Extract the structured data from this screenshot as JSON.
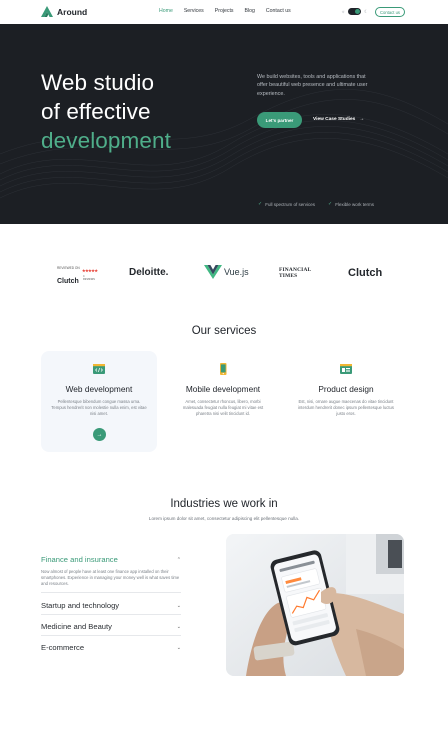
{
  "header": {
    "logo_text": "Around",
    "nav": [
      {
        "label": "Home",
        "active": true
      },
      {
        "label": "Services",
        "active": false
      },
      {
        "label": "Projects",
        "active": false
      },
      {
        "label": "Blog",
        "active": false
      },
      {
        "label": "Contact us",
        "active": false
      }
    ],
    "contact_button": "Contact us",
    "theme_toggle": {
      "on": true,
      "sun_icon": "sun-icon",
      "moon_icon": "moon-icon"
    }
  },
  "hero": {
    "title_line1": "Web studio",
    "title_line2": "of effective",
    "title_accent": "development",
    "description": "We build websites, tools and applications that offer beautiful web presence and ultimate user experience.",
    "primary_button": "Let's partner",
    "secondary_button": "View Case Studies",
    "checks": [
      "Full spectrum of services",
      "Flexible work terms"
    ]
  },
  "logos": {
    "clutch_small": {
      "reviewed": "REVIEWED ON",
      "brand": "Clutch",
      "stars": "★★★★★",
      "reviews": "4 REVIEWS"
    },
    "deloitte": "Deloitte.",
    "vue": "Vue.js",
    "ft_line1": "FINANCIAL",
    "ft_line2": "TIMES",
    "clutch_big": "Clutch"
  },
  "services": {
    "title": "Our services",
    "items": [
      {
        "title": "Web development",
        "description": "Pellentesque bibendum congue massa urna. Tempus hendrerit non molestie nulla enim, est vitae nisi amet.",
        "icon": "code-icon",
        "featured": true
      },
      {
        "title": "Mobile development",
        "description": "Amet, consectetur rhoncus, libero, morbi malesuada feugiat nulla feugiat mi vitae est pharetra nisi velit tincidunt id.",
        "icon": "mobile-icon",
        "featured": false
      },
      {
        "title": "Product design",
        "description": "Est, nisi, ornare augue maecenas do vitae tincidunt interdum hendrerit donec ipsum pellentesque luctus justo eros.",
        "icon": "design-icon",
        "featured": false
      }
    ]
  },
  "industries": {
    "title": "Industries we work in",
    "subtitle": "Lorem ipsum dolor sit amet, consectetur adipiscing elit pellentesque nulla.",
    "items": [
      {
        "title": "Finance and insurance",
        "expanded": true,
        "body": "Now almost of people have at least one finance app installed on their smartphones. Experience in managing your money well is what saves time and resources."
      },
      {
        "title": "Startup and technology",
        "expanded": false
      },
      {
        "title": "Medicine and Beauty",
        "expanded": false
      },
      {
        "title": "E-commerce",
        "expanded": false
      }
    ],
    "photo_alt": "hands-holding-phone-image"
  },
  "colors": {
    "accent": "#3a9a78",
    "hero_bg": "#1c1f24",
    "text_dark": "#1f2329"
  }
}
